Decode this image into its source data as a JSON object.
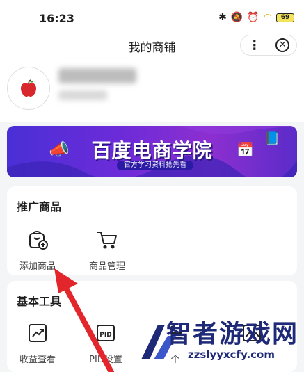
{
  "status_bar": {
    "time": "16:23",
    "battery": "69"
  },
  "nav": {
    "title": "我的商铺",
    "more_icon": "⋮",
    "close_icon": "✕"
  },
  "banner": {
    "title": "百度电商学院",
    "subtitle": "官方学习资料抢先看"
  },
  "promote": {
    "title": "推广商品",
    "items": [
      {
        "label": "添加商品",
        "icon": "add-product-icon"
      },
      {
        "label": "商品管理",
        "icon": "cart-icon"
      }
    ]
  },
  "tools": {
    "title": "基本工具",
    "items": [
      {
        "label": "收益查看",
        "icon": "trend-chart-icon"
      },
      {
        "label": "PID设置",
        "icon": "pid-icon"
      },
      {
        "label": "个",
        "icon": "settings-icon"
      }
    ]
  },
  "watermark": {
    "brand": "智者游戏网",
    "url": "zzslyyxcfy.com"
  },
  "colors": {
    "accent_red": "#e3262c",
    "banner_purple": "#6d2bd8",
    "watermark_blue": "#1e2a78"
  }
}
